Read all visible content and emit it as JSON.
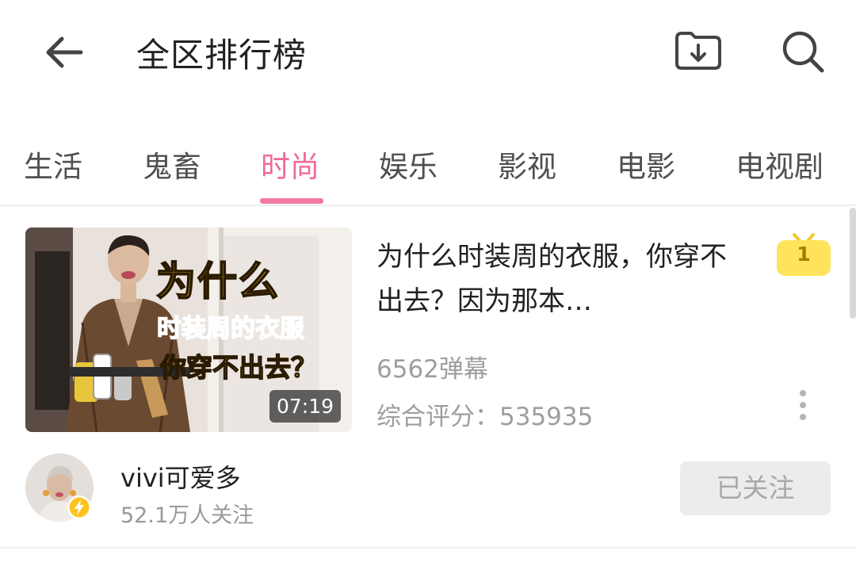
{
  "header": {
    "title": "全区排行榜",
    "icons": {
      "back": "back-arrow-icon",
      "download": "download-icon",
      "search": "search-icon"
    }
  },
  "tabs": [
    {
      "label": "生活",
      "active": false
    },
    {
      "label": "鬼畜",
      "active": false
    },
    {
      "label": "时尚",
      "active": true
    },
    {
      "label": "娱乐",
      "active": false
    },
    {
      "label": "影视",
      "active": false
    },
    {
      "label": "电影",
      "active": false
    },
    {
      "label": "电视剧",
      "active": false
    }
  ],
  "video": {
    "thumbnail_caption_line1": "为什么",
    "thumbnail_caption_line2": "时装周的衣服",
    "thumbnail_caption_line3": "你穿不出去？",
    "duration": "07:19",
    "title": "为什么时装周的衣服，你穿不出去？因为那本…",
    "rank": "1",
    "danmaku": "6562弹幕",
    "score": "综合评分：535935"
  },
  "author": {
    "name": "vivi可爱多",
    "followers": "52.1万人关注",
    "follow_label": "已关注"
  },
  "colors": {
    "accent": "#f06b98",
    "rank_badge": "#ffe35c",
    "follow_button_bg": "#ececec",
    "secondary_text": "#9e9e9e"
  }
}
